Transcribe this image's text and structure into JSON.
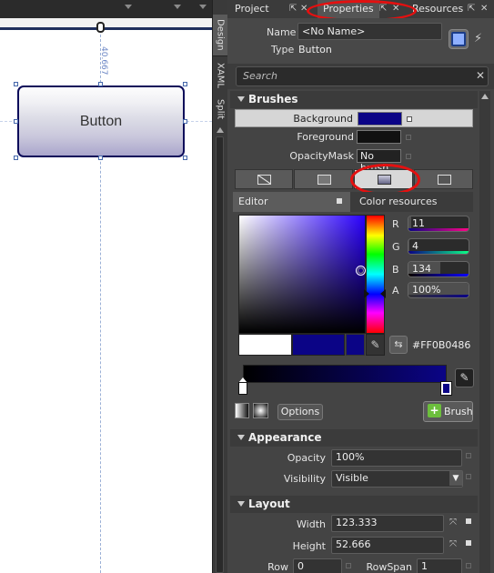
{
  "canvas": {
    "button_text": "Button",
    "dimension_label": "40.667"
  },
  "view_tabs": [
    "Design",
    "XAML",
    "Split"
  ],
  "panel_tabs": {
    "project": "Project",
    "properties": "Properties",
    "resources": "Resources"
  },
  "header": {
    "name_label": "Name",
    "name_value": "<No Name>",
    "type_label": "Type",
    "type_value": "Button"
  },
  "search": {
    "placeholder": "Search"
  },
  "brushes": {
    "title": "Brushes",
    "rows": [
      {
        "name": "Background",
        "swatch_color": "#0B0486"
      },
      {
        "name": "Foreground",
        "swatch_color": "#111111"
      },
      {
        "name": "OpacityMask",
        "value": "No brush"
      }
    ],
    "editor_tab": "Editor",
    "color_resources_tab": "Color resources",
    "channels": [
      {
        "label": "R",
        "value": "11",
        "fraction": 0.043,
        "grad": "linear-gradient(to right,#0b0486,#ff0486)"
      },
      {
        "label": "G",
        "value": "4",
        "fraction": 0.016,
        "grad": "linear-gradient(to right,#0b0086,#0bff86)"
      },
      {
        "label": "B",
        "value": "134",
        "fraction": 0.525,
        "grad": "linear-gradient(to right,#0b0400,#0b04ff)"
      },
      {
        "label": "A",
        "value": "100%",
        "fraction": 1.0,
        "grad": "linear-gradient(to right,#333,#0b0486)"
      }
    ],
    "hex": "#FF0B0486",
    "options_label": "Options",
    "brush_button_label": "Brush"
  },
  "appearance": {
    "title": "Appearance",
    "opacity_label": "Opacity",
    "opacity_value": "100%",
    "visibility_label": "Visibility",
    "visibility_value": "Visible"
  },
  "layout": {
    "title": "Layout",
    "width_label": "Width",
    "width_value": "123.333",
    "height_label": "Height",
    "height_value": "52.666",
    "row_label": "Row",
    "row_value": "0",
    "rowspan_label": "RowSpan",
    "rowspan_value": "1"
  },
  "colors": {
    "selected_brush": "#0B0486",
    "highlight": "#E41010",
    "panel_bg": "#444444"
  },
  "icons": [
    "dropdown-arrow-icon",
    "pin-icon",
    "close-icon",
    "events-icon",
    "properties-icon",
    "eyedropper-icon",
    "swap-icon",
    "reset-icon",
    "advanced-property-icon"
  ]
}
